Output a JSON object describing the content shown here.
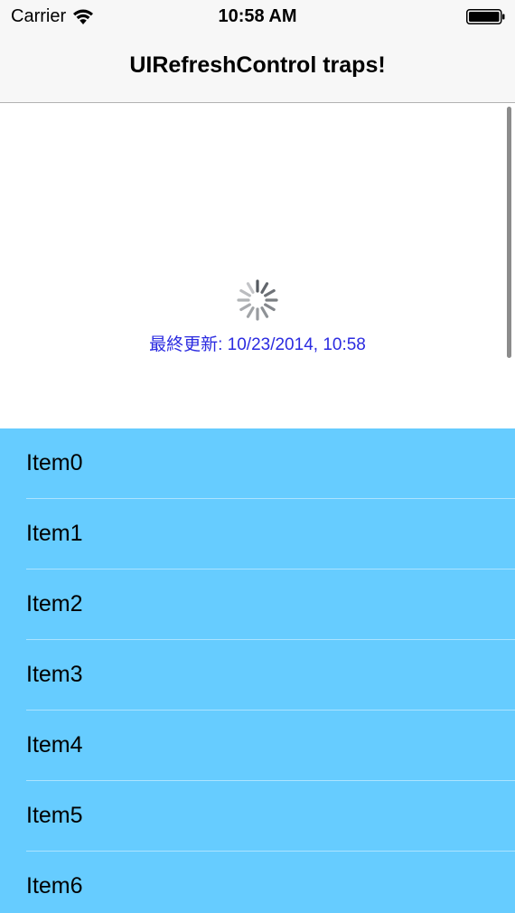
{
  "status_bar": {
    "carrier": "Carrier",
    "time": "10:58 AM",
    "wifi_icon": "wifi-icon",
    "battery_icon": "battery-icon"
  },
  "nav_bar": {
    "title": "UIRefreshControl traps!"
  },
  "refresh_control": {
    "spinner_icon": "activity-spinner-icon",
    "last_updated": "最終更新: 10/23/2014, 10:58",
    "text_color": "#2b2be0"
  },
  "table": {
    "background_color": "#66ccff",
    "items": [
      {
        "label": "Item0"
      },
      {
        "label": "Item1"
      },
      {
        "label": "Item2"
      },
      {
        "label": "Item3"
      },
      {
        "label": "Item4"
      },
      {
        "label": "Item5"
      },
      {
        "label": "Item6"
      }
    ]
  }
}
